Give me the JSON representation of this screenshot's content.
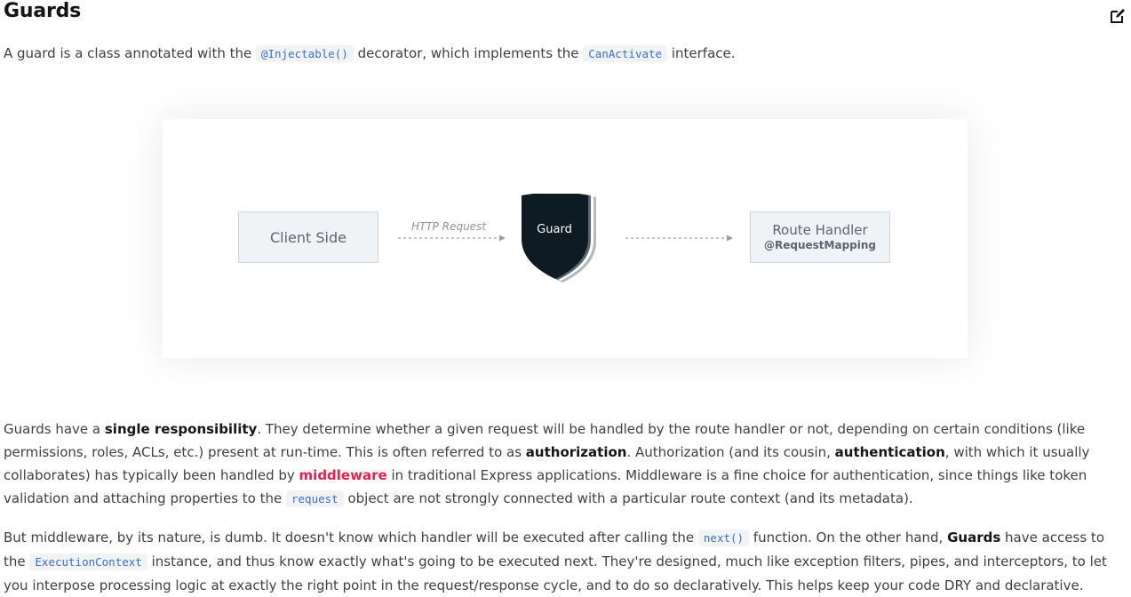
{
  "title": "Guards",
  "intro": {
    "t1": "A guard is a class annotated with the ",
    "c1": "@Injectable()",
    "t2": " decorator, which implements the ",
    "c2": "CanActivate",
    "t3": " interface."
  },
  "diagram": {
    "client_label": "Client Side",
    "http_label": "HTTP Request",
    "guard_label": "Guard",
    "route_title": "Route Handler",
    "route_sub": "@RequestMapping"
  },
  "para1": {
    "t1": "Guards have a ",
    "b1": "single responsibility",
    "t2": ". They determine whether a given request will be handled by the route handler or not, depending on certain conditions (like permissions, roles, ACLs, etc.) present at run-time. This is often referred to as ",
    "b2": "authorization",
    "t3": ". Authorization (and its cousin, ",
    "b3": "authentication",
    "t4": ", with which it usually collaborates) has typically been handled by ",
    "link": "middleware",
    "t5": " in traditional Express applications. Middleware is a fine choice for authentication, since things like token validation and attaching properties to the ",
    "c1": "request",
    "t6": " object are not strongly connected with a particular route context (and its metadata)."
  },
  "para2": {
    "t1": "But middleware, by its nature, is dumb. It doesn't know which handler will be executed after calling the ",
    "c1": "next()",
    "t2": " function. On the other hand, ",
    "b1": "Guards",
    "t3": " have access to the ",
    "c2": "ExecutionContext",
    "t4": " instance, and thus know exactly what's going to be executed next. They're designed, much like exception filters, pipes, and interceptors, to let you interpose processing logic at exactly the right point in the request/response cycle, and to do so declaratively. This helps keep your code DRY and declarative."
  },
  "colors": {
    "accent": "#e0234e",
    "code": "#3b6fc4",
    "guard_dark": "#0e1a24"
  },
  "icons": {
    "edit": "edit-icon",
    "guard": "shield-icon"
  }
}
